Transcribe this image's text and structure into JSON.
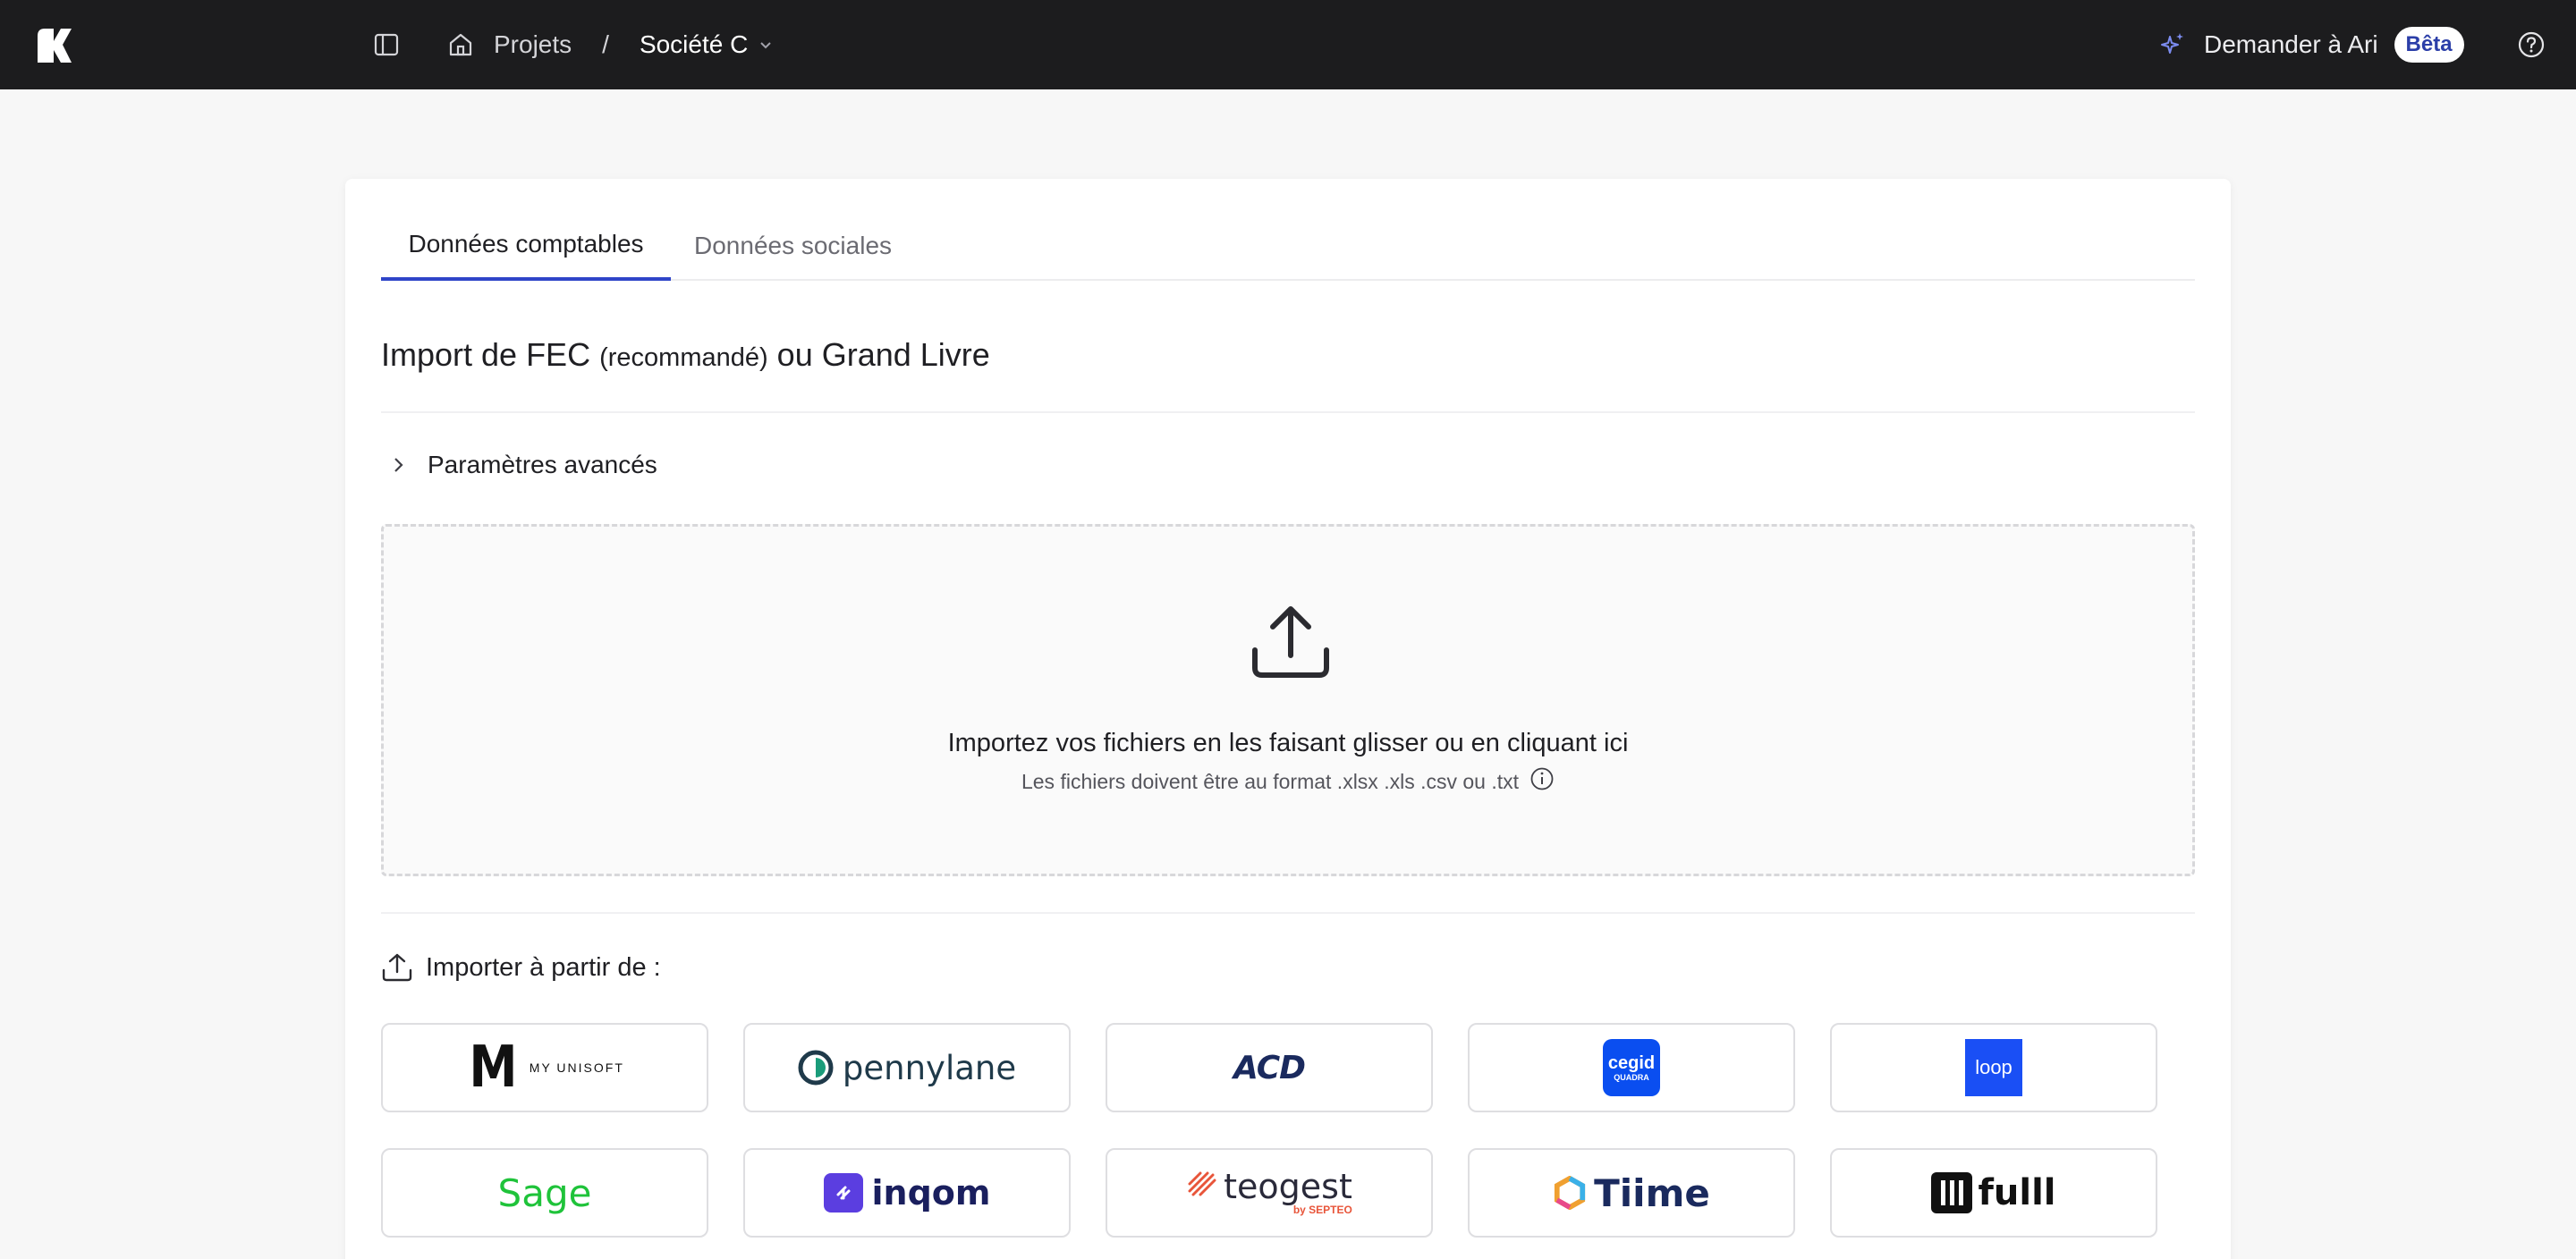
{
  "topbar": {
    "breadcrumb": {
      "projects": "Projets",
      "separator": "/",
      "company": "Société C"
    },
    "ask_ari": {
      "label": "Demander à Ari",
      "badge": "Bêta"
    }
  },
  "tabs": [
    {
      "label": "Données comptables",
      "active": true
    },
    {
      "label": "Données sociales",
      "active": false
    }
  ],
  "section": {
    "title_main": "Import de FEC",
    "title_note": "(recommandé)",
    "title_end": "ou Grand Livre"
  },
  "advanced_settings": "Paramètres avancés",
  "dropzone": {
    "main_text": "Importez vos fichiers en les faisant glisser ou en cliquant ici",
    "sub_text": "Les fichiers doivent être au format .xlsx .xls .csv ou .txt"
  },
  "import_from": "Importer à partir de :",
  "providers": {
    "myunisoft": {
      "mark": "M",
      "label": "MY UNISOFT"
    },
    "pennylane": {
      "label": "pennylane"
    },
    "acd": {
      "label": "ACD"
    },
    "cegid": {
      "label": "cegid",
      "sub": "QUADRA"
    },
    "loop": {
      "label": "loop"
    },
    "sage": {
      "label": "Sage"
    },
    "inqom": {
      "label": "inqom"
    },
    "teogest": {
      "label": "teogest",
      "sub": "by SEPTEO"
    },
    "tiime": {
      "label": "Tiime"
    },
    "fulll": {
      "label": "fulll"
    }
  },
  "colors": {
    "topbar_bg": "#1c1c1e",
    "accent": "#2f45c8",
    "cegid_blue": "#0a4ef0",
    "loop_blue": "#1a4ff5",
    "sage_green": "#1fc33a",
    "inqom_purple": "#5b3ee0",
    "teogest_red": "#e8553a"
  }
}
